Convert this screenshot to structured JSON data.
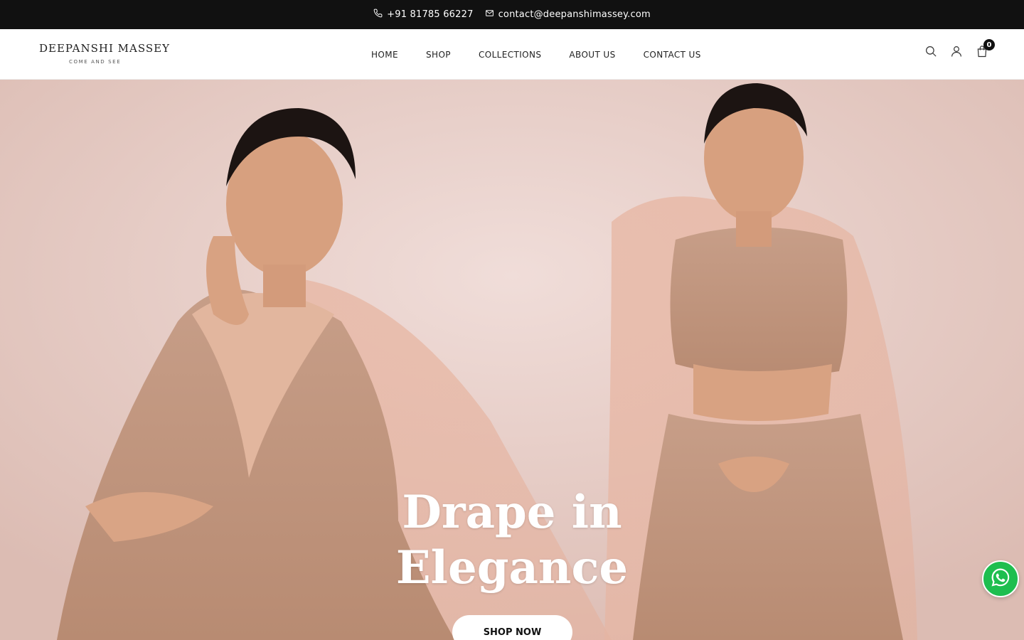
{
  "topbar": {
    "phone": "+91 81785 66227",
    "email": "contact@deepanshimassey.com"
  },
  "brand": {
    "name": "DEEPANSHI MASSEY",
    "tagline": "COME AND SEE"
  },
  "nav": {
    "items": [
      "HOME",
      "SHOP",
      "COLLECTIONS",
      "ABOUT US",
      "CONTACT US"
    ]
  },
  "header_icons": {
    "search": "search-icon",
    "account": "user-icon",
    "cart": "bag-icon",
    "cart_count": "0"
  },
  "hero": {
    "title_line1": "Drape in",
    "title_line2": "Elegance",
    "cta_label": "SHOP NOW"
  },
  "floating": {
    "whatsapp": "whatsapp-icon"
  },
  "colors": {
    "topbar_bg": "#111111",
    "hero_bg": "#e6cbc4",
    "whatsapp": "#1ebe4f"
  }
}
